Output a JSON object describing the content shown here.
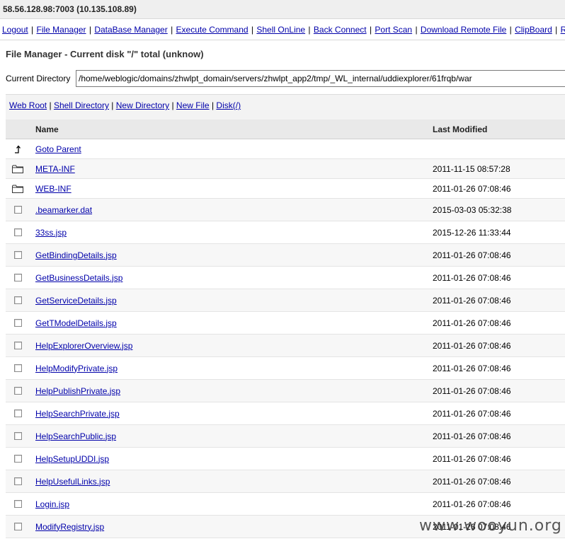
{
  "host": "58.56.128.98:7003 (10.135.108.89)",
  "menu": [
    "Logout",
    "File Manager",
    "DataBase Manager",
    "Execute Command",
    "Shell OnLine",
    "Back Connect",
    "Port Scan",
    "Download Remote File",
    "ClipBoard",
    "Re"
  ],
  "page_title": "File Manager - Current disk \"/\" total (unknow)",
  "current_directory": {
    "label": "Current Directory",
    "value": "/home/weblogic/domains/zhwlpt_domain/servers/zhwlpt_app2/tmp/_WL_internal/uddiexplorer/61frqb/war"
  },
  "shortcuts": [
    "Web Root",
    "Shell Directory",
    "New Directory",
    "New File",
    "Disk(/)"
  ],
  "table": {
    "headers": {
      "name": "Name",
      "modified": "Last Modified"
    },
    "parent": {
      "name": "Goto Parent"
    },
    "folders": [
      {
        "name": "META-INF",
        "modified": "2011-11-15 08:57:28"
      },
      {
        "name": "WEB-INF",
        "modified": "2011-01-26 07:08:46"
      }
    ],
    "files": [
      {
        "name": ".beamarker.dat",
        "modified": "2015-03-03 05:32:38"
      },
      {
        "name": "33ss.jsp",
        "modified": "2015-12-26 11:33:44"
      },
      {
        "name": "GetBindingDetails.jsp",
        "modified": "2011-01-26 07:08:46"
      },
      {
        "name": "GetBusinessDetails.jsp",
        "modified": "2011-01-26 07:08:46"
      },
      {
        "name": "GetServiceDetails.jsp",
        "modified": "2011-01-26 07:08:46"
      },
      {
        "name": "GetTModelDetails.jsp",
        "modified": "2011-01-26 07:08:46"
      },
      {
        "name": "HelpExplorerOverview.jsp",
        "modified": "2011-01-26 07:08:46"
      },
      {
        "name": "HelpModifyPrivate.jsp",
        "modified": "2011-01-26 07:08:46"
      },
      {
        "name": "HelpPublishPrivate.jsp",
        "modified": "2011-01-26 07:08:46"
      },
      {
        "name": "HelpSearchPrivate.jsp",
        "modified": "2011-01-26 07:08:46"
      },
      {
        "name": "HelpSearchPublic.jsp",
        "modified": "2011-01-26 07:08:46"
      },
      {
        "name": "HelpSetupUDDI.jsp",
        "modified": "2011-01-26 07:08:46"
      },
      {
        "name": "HelpUsefulLinks.jsp",
        "modified": "2011-01-26 07:08:46"
      },
      {
        "name": "Login.jsp",
        "modified": "2011-01-26 07:08:46"
      },
      {
        "name": "ModifyRegistry.jsp",
        "modified": "2011-01-26 07:08:46"
      }
    ]
  },
  "watermark": "www.wooyun.org",
  "icons": {
    "parent": "up-arrow-icon",
    "folder": "folder-icon",
    "file": "checkbox"
  }
}
